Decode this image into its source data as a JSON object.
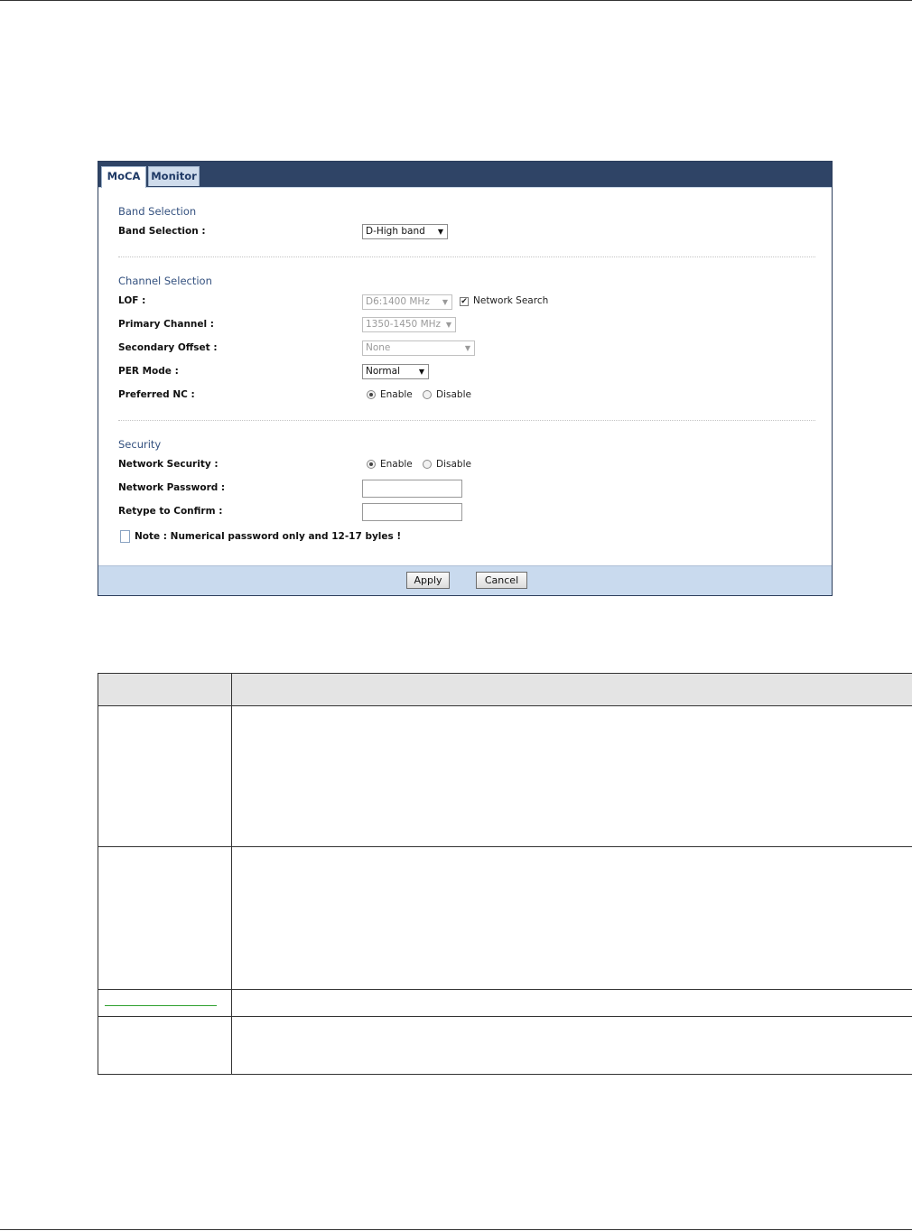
{
  "tabs": [
    {
      "label": "MoCA"
    },
    {
      "label": "Monitor"
    }
  ],
  "band_section": {
    "title": "Band Selection",
    "label": "Band Selection :",
    "value": "D-High band"
  },
  "channel_section": {
    "title": "Channel Selection",
    "lof_label": "LOF :",
    "lof_value": "D6:1400 MHz",
    "network_search_label": "Network Search",
    "network_search_checked": true,
    "primary_label": "Primary Channel :",
    "primary_value": "1350-1450 MHz",
    "secondary_label": "Secondary Offset :",
    "secondary_value": "None",
    "per_label": "PER Mode :",
    "per_value": "Normal",
    "preferred_label": "Preferred NC :",
    "enable_label": "Enable",
    "disable_label": "Disable",
    "preferred_selected": "Enable"
  },
  "security_section": {
    "title": "Security",
    "network_security_label": "Network Security :",
    "enable_label": "Enable",
    "disable_label": "Disable",
    "network_security_selected": "Enable",
    "password_label": "Network Password :",
    "password_value": "",
    "confirm_label": "Retype to Confirm :",
    "confirm_value": "",
    "note": "Note : Numerical password only and 12-17 byles !"
  },
  "buttons": {
    "apply": "Apply",
    "cancel": "Cancel"
  },
  "colors": {
    "tab_bar": "#2f4466",
    "section_title": "#34517f",
    "footer": "#c9daee",
    "table_header": "#e4e4e4",
    "link_underline": "#2fa02f"
  }
}
